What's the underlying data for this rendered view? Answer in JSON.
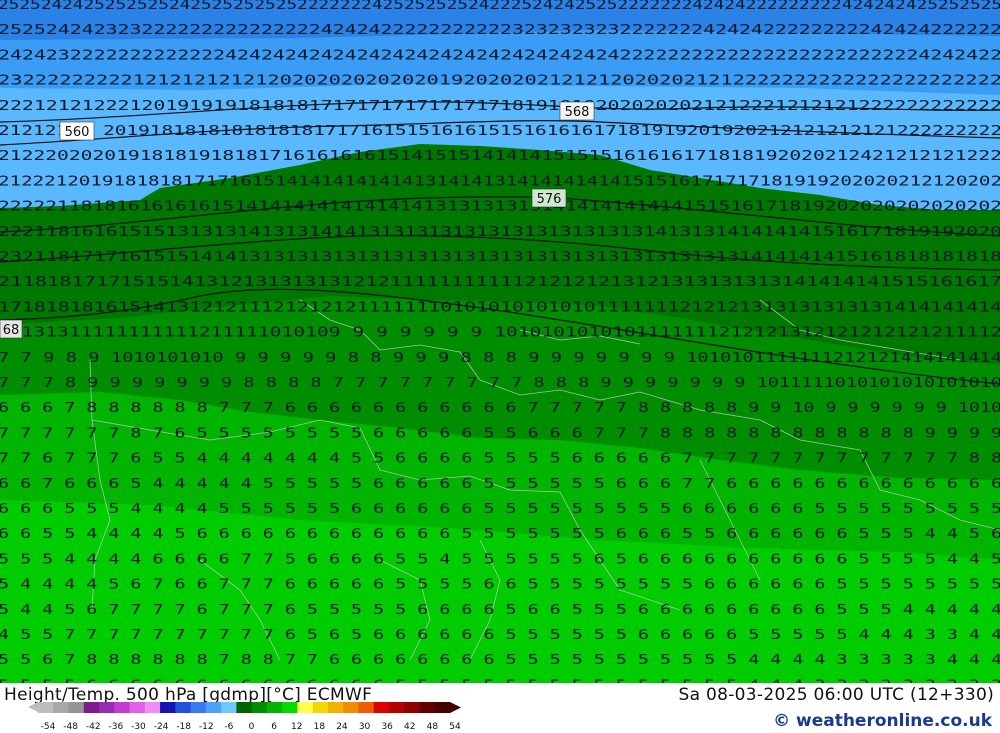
{
  "footer": {
    "title": "Height/Temp. 500 hPa [gdmp][°C] ECMWF",
    "valid_time": "Sa 08-03-2025 06:00 UTC (12+330)",
    "brand": "© weatheronline.co.uk"
  },
  "contour_labels": [
    "560",
    "568",
    "576",
    "68"
  ],
  "legend": {
    "ticks": [
      "-54",
      "-48",
      "-42",
      "-36",
      "-30",
      "-24",
      "-18",
      "-12",
      "-6",
      "0",
      "6",
      "12",
      "18",
      "24",
      "30",
      "36",
      "42",
      "48",
      "54"
    ],
    "colors": [
      "#bdbdbd",
      "#a8a8a8",
      "#959595",
      "#7a1f8a",
      "#9a2bb0",
      "#c43ad2",
      "#e060e8",
      "#f08ef5",
      "#1414b4",
      "#2050dc",
      "#3c78f0",
      "#50a0f8",
      "#70c8ff",
      "#006400",
      "#008c00",
      "#00b400",
      "#00dc00",
      "#ffff50",
      "#f0d800",
      "#f0b400",
      "#f08c00",
      "#f05a00",
      "#dc0000",
      "#b40000",
      "#8c0000",
      "#640000",
      "#460000"
    ]
  },
  "map_colors": {
    "blue_dark": "#2a82e6",
    "blue_mid": "#3a9cf4",
    "blue_light": "#5ab8ff",
    "green_dark": "#007800",
    "green_mid": "#008e00",
    "green_light": "#00b400",
    "green_bright": "#00cc00"
  },
  "map_text_rows": [
    "2525242425252525242525252525222222242525252524222524242525222222242424222222222424242425252525",
    "252524242323222222222222222424242222222222232323232322222224242422222222242424222222",
    "242423222222222222242424242424242424242424242424242422222222222222222222222224242422",
    "2322222222212121212121202020202020201920202021212120202021212222222222222222222222",
    "222121212221201919191818181717171717171717181919192020202021212221212121222222222222",
    "21212121 20191818181818181817171615151616151516161617181919201920212121212121222222222",
    "2122202020191818191818171616161615141515141414151515161616171818192020212421212121222",
    "212221201918181817171615141414141414131414131414141414151516171717181919202020212120202",
    "2222211818161616161514141414141414141313131313141414141414151516171819202020202020202",
    "222118161615151313131413131414131313131313131313131313141313141414141516171819192020",
    "232118171716151514141313131313131313131313131313131313131313131414141415161818181818",
    "2118181717151514131213131313121211111111111212121213121313131313141414141515161617",
    "171818181615141312121112121212111111101010101010101111111212121313131313131414141414",
    "12131311111111111211111010109 9 9 9 9 9 9 1010101010101111111212121312121212121211112",
    "7 7 9 8 9 1010101010 9 9 9 9 9 8 8 9 9 9 8 8 8 9 9 9 9 9 9 9 1010101111111212121414141414",
    "7 7 7 8 9 9 9 9 9 9 9 8 8 8 8 7 7 7 7 7 7 7 7 7 8 8 8 9 9 9 9 9 9 9 1011111010101010101010",
    "6 6 6 7 8 8 8 8 8 8 7 7 7 6 6 6 6 6 6 6 6 6 6 6 7 7 7 7 7 8 8 8 8 8 9 9 10 9 9 9 9 9 9 1010",
    "7 7 7 7 7 7 8 7 6 5 5 5 5 5 5 5 5 6 6 6 6 6 5 5 6 6 6 7 7 7 8 8 8 8 8 8 8 8 8 8 8 8 9 9 9 9",
    "7 7 6 7 7 7 6 5 5 4 4 4 4 4 4 4 5 5 6 6 6 6 5 5 5 5 6 6 6 6 6 7 7 7 7 7 7 7 7 7 7 7 7 7 8 8",
    "6 6 7 6 6 6 5 4 4 4 4 4 5 5 5 5 5 6 6 6 6 6 5 5 5 5 5 5 6 6 6 7 7 6 6 6 6 6 6 6 6 6 6 6 6 6",
    "6 6 6 5 5 5 4 4 4 4 5 5 5 5 5 5 6 6 6 6 6 6 5 5 5 5 5 5 5 5 5 6 6 6 6 6 6 5 5 5 5 5 5 5 5 5",
    "6 6 5 5 4 4 4 4 5 6 6 6 6 6 6 6 6 6 6 6 6 5 5 5 5 5 5 5 6 6 6 5 5 6 6 6 6 6 6 5 5 5 4 4 5 6",
    "5 5 5 4 4 4 4 6 6 6 6 7 7 5 6 6 6 6 5 5 4 5 5 5 5 5 5 6 5 6 6 6 6 6 6 6 6 6 6 5 5 5 5 4 4 5",
    "5 4 4 4 4 5 6 7 6 6 7 7 7 6 6 6 6 6 5 5 5 5 6 6 5 5 5 5 5 5 5 5 6 6 6 6 6 6 5 5 5 5 5 5 5 5",
    "5 4 4 5 6 7 7 7 7 6 7 7 7 6 5 5 5 5 5 6 6 6 6 5 6 6 5 5 5 6 6 6 6 6 6 6 6 6 5 5 5 4 4 4 4 4",
    "4 5 5 7 7 7 7 7 7 7 7 7 7 6 5 6 5 6 6 6 6 6 6 5 5 5 5 5 5 6 6 6 6 6 5 5 5 5 5 4 4 4 3 3 4 4",
    "5 5 6 7 8 8 8 8 8 8 7 8 8 7 7 6 6 6 6 6 6 6 6 5 5 5 5 5 5 5 5 5 5 5 4 4 4 4 3 3 3 3 3 4 4 4",
    "5 5 5 5 6 6 6 6 6 6 6 6 6 6 6 6 6 6 5 5 5 5 5 5 5 5 5 5 5 5 5 5 5 5 4 4 4 3 3 3 3 3 3 3 3 3"
  ]
}
